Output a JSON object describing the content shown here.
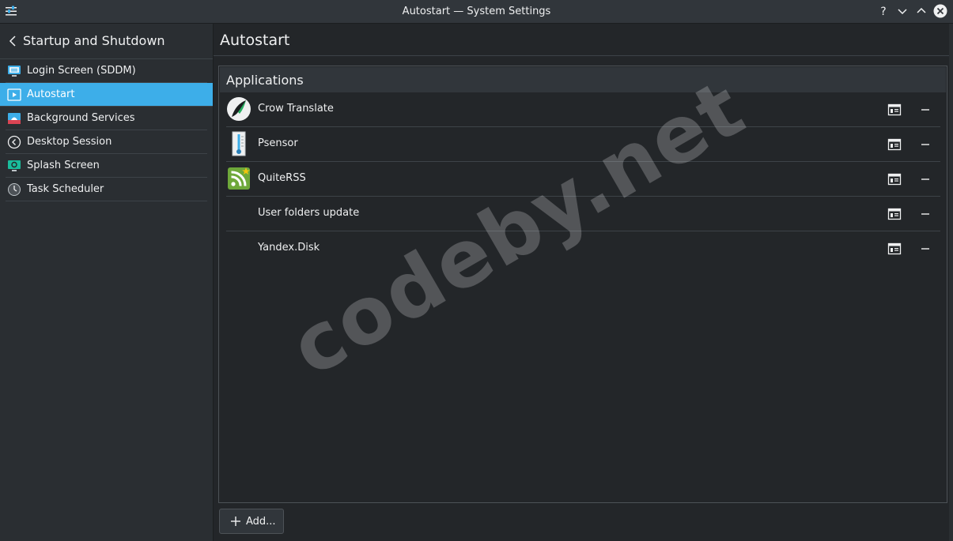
{
  "window": {
    "title": "Autostart — System Settings",
    "icons": [
      "settings-sliders-icon",
      "help-icon",
      "minimize-icon",
      "maximize-icon",
      "close-icon"
    ]
  },
  "sidebar": {
    "header": "Startup and Shutdown",
    "items": [
      {
        "label": "Login Screen (SDDM)",
        "icon": "login-screen-icon",
        "active": false
      },
      {
        "label": "Autostart",
        "icon": "autostart-icon",
        "active": true
      },
      {
        "label": "Background Services",
        "icon": "background-services-icon",
        "active": false
      },
      {
        "label": "Desktop Session",
        "icon": "desktop-session-icon",
        "active": false
      },
      {
        "label": "Splash Screen",
        "icon": "splash-screen-icon",
        "active": false
      },
      {
        "label": "Task Scheduler",
        "icon": "clock-icon",
        "active": false
      }
    ]
  },
  "main": {
    "title": "Autostart",
    "section_title": "Applications",
    "apps": [
      {
        "name": "Crow Translate",
        "icon": "crow-translate-icon"
      },
      {
        "name": "Psensor",
        "icon": "thermometer-icon"
      },
      {
        "name": "QuiteRSS",
        "icon": "rss-icon"
      },
      {
        "name": "User folders update",
        "icon": ""
      },
      {
        "name": "Yandex.Disk",
        "icon": ""
      }
    ],
    "add_label": "Add..."
  },
  "watermark": "codeby.net",
  "colors": {
    "accent": "#3daee9",
    "background": "#232629",
    "sidebar": "#2a2e32",
    "text": "#eff0f1"
  }
}
